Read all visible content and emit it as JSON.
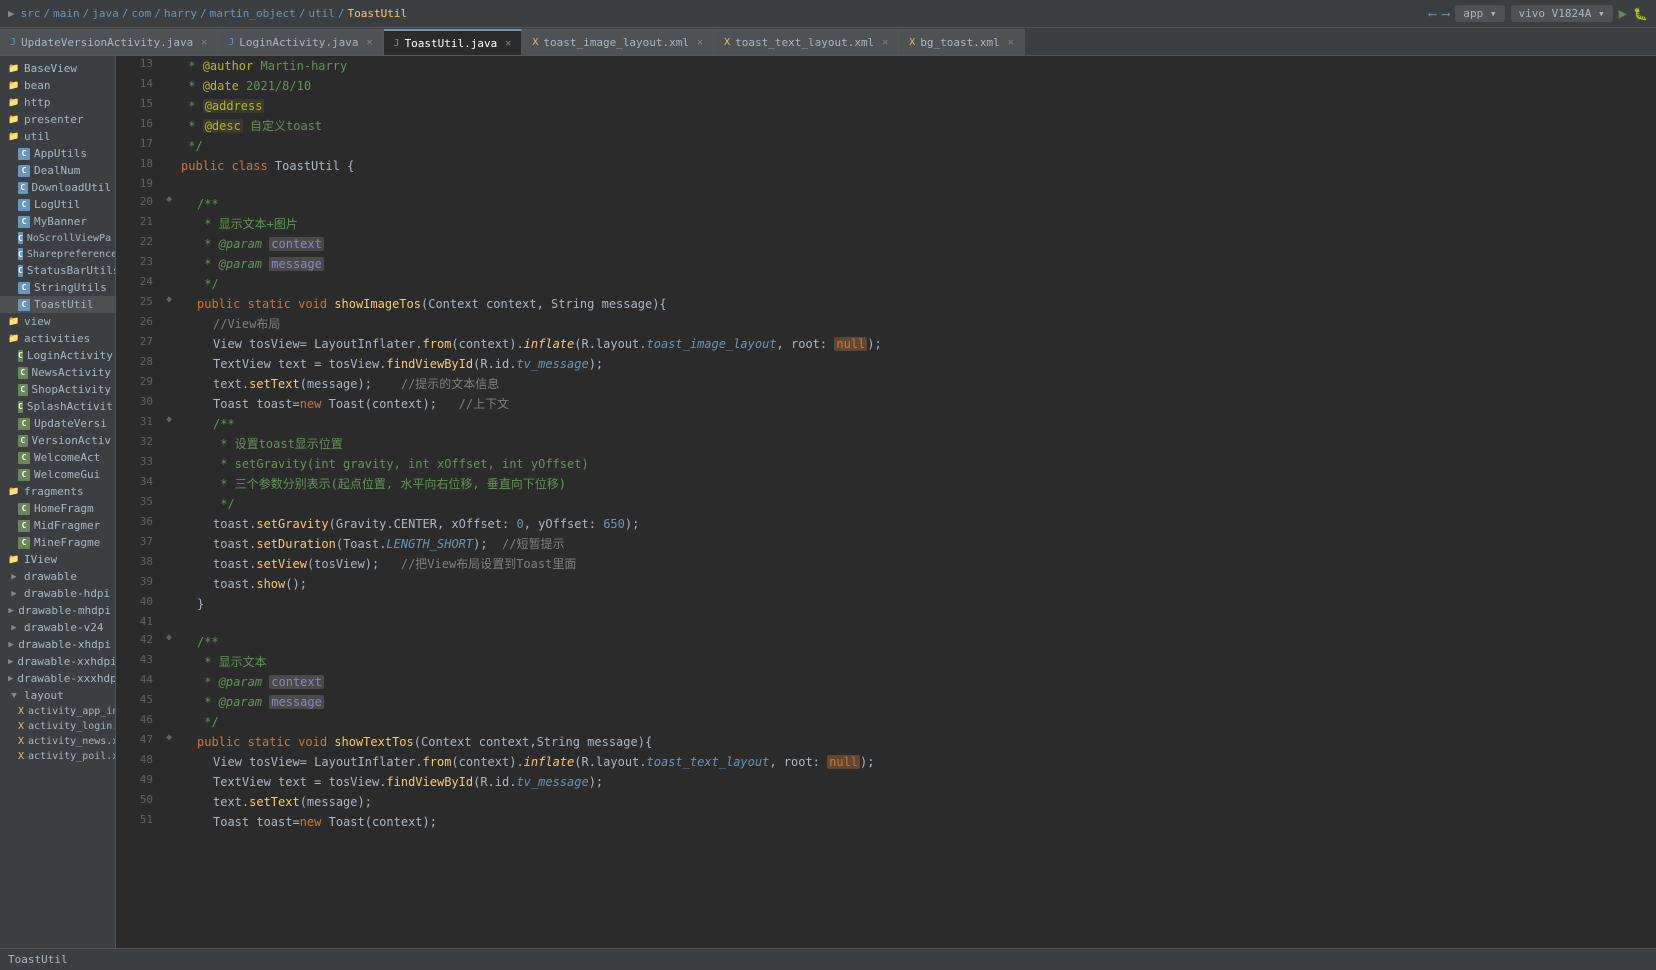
{
  "topbar": {
    "breadcrumbs": [
      "src",
      "main",
      "java",
      "com",
      "harry",
      "martin_object",
      "util",
      "ToastUtil"
    ]
  },
  "tabs": [
    {
      "id": "UpdateVersionActivity",
      "label": "UpdateVersionActivity.java",
      "type": "java",
      "active": false
    },
    {
      "id": "LoginActivity",
      "label": "LoginActivity.java",
      "type": "java",
      "active": false
    },
    {
      "id": "ToastUtil",
      "label": "ToastUtil.java",
      "type": "java",
      "active": true
    },
    {
      "id": "toast_image_layout",
      "label": "toast_image_layout.xml",
      "type": "xml",
      "active": false
    },
    {
      "id": "toast_text_layout",
      "label": "toast_text_layout.xml",
      "type": "xml",
      "active": false
    },
    {
      "id": "bg_toast",
      "label": "bg_toast.xml",
      "type": "xml",
      "active": false
    }
  ],
  "sidebar": {
    "sections": [
      {
        "type": "item",
        "label": "BaseView",
        "icon": "folder"
      },
      {
        "type": "item",
        "label": "bean",
        "icon": "folder"
      },
      {
        "type": "item",
        "label": "http",
        "icon": "folder"
      },
      {
        "type": "item",
        "label": "presenter",
        "icon": "folder"
      },
      {
        "type": "item",
        "label": "util",
        "icon": "folder"
      },
      {
        "type": "class",
        "label": "AppUtils",
        "icon": "blue"
      },
      {
        "type": "class",
        "label": "DealNum",
        "icon": "blue"
      },
      {
        "type": "class",
        "label": "DownloadUtil",
        "icon": "blue"
      },
      {
        "type": "class",
        "label": "LogUtil",
        "icon": "blue"
      },
      {
        "type": "class",
        "label": "MyBanner",
        "icon": "blue"
      },
      {
        "type": "class",
        "label": "NoScrollViewPa",
        "icon": "blue"
      },
      {
        "type": "class",
        "label": "Sharepreferences",
        "icon": "blue"
      },
      {
        "type": "class",
        "label": "StatusBarUtils",
        "icon": "blue"
      },
      {
        "type": "class",
        "label": "StringUtils",
        "icon": "blue"
      },
      {
        "type": "class",
        "label": "ToastUtil",
        "icon": "blue"
      },
      {
        "type": "item",
        "label": "view",
        "icon": "folder"
      },
      {
        "type": "item",
        "label": "activities",
        "icon": "folder"
      },
      {
        "type": "class",
        "label": "LoginActivity",
        "icon": "green"
      },
      {
        "type": "class",
        "label": "NewsActivity",
        "icon": "green"
      },
      {
        "type": "class",
        "label": "ShopActivity",
        "icon": "green"
      },
      {
        "type": "class",
        "label": "SplashActivit",
        "icon": "green"
      },
      {
        "type": "class",
        "label": "UpdateVersi",
        "icon": "green"
      },
      {
        "type": "class",
        "label": "VersionActiv",
        "icon": "green"
      },
      {
        "type": "class",
        "label": "WelcomeAct",
        "icon": "green"
      },
      {
        "type": "class",
        "label": "WelcomeGui",
        "icon": "green"
      },
      {
        "type": "item",
        "label": "fragments",
        "icon": "folder"
      },
      {
        "type": "class",
        "label": "HomeFragm",
        "icon": "green"
      },
      {
        "type": "class",
        "label": "MidFragmer",
        "icon": "green"
      },
      {
        "type": "class",
        "label": "MineFragme",
        "icon": "green"
      },
      {
        "type": "item",
        "label": "IView",
        "icon": "folder"
      },
      {
        "type": "item",
        "label": "drawable",
        "icon": "folder"
      },
      {
        "type": "item",
        "label": "drawable-hdpi",
        "icon": "folder"
      },
      {
        "type": "item",
        "label": "drawable-mhdpi",
        "icon": "folder"
      },
      {
        "type": "item",
        "label": "drawable-v24",
        "icon": "folder"
      },
      {
        "type": "item",
        "label": "drawable-xhdpi",
        "icon": "folder"
      },
      {
        "type": "item",
        "label": "drawable-xxhdpi",
        "icon": "folder"
      },
      {
        "type": "item",
        "label": "drawable-xxxhdpi",
        "icon": "folder"
      },
      {
        "type": "item",
        "label": "layout",
        "icon": "folder"
      },
      {
        "type": "file",
        "label": "activity_app_info.xml",
        "icon": "xml"
      },
      {
        "type": "file",
        "label": "activity_login.xml",
        "icon": "xml"
      },
      {
        "type": "file",
        "label": "activity_news.xml",
        "icon": "xml"
      },
      {
        "type": "file",
        "label": "activity_poil.xml",
        "icon": "xml"
      }
    ]
  },
  "code": {
    "lines": [
      {
        "num": 13,
        "gutter": "",
        "text": " * @author Martin-harry"
      },
      {
        "num": 14,
        "gutter": "",
        "text": " * @date 2021/8/10"
      },
      {
        "num": 15,
        "gutter": "",
        "text": " * @address"
      },
      {
        "num": 16,
        "gutter": "",
        "text": " * @desc 自定义toast"
      },
      {
        "num": 17,
        "gutter": "",
        "text": " */"
      },
      {
        "num": 18,
        "gutter": "",
        "text": "public class ToastUtil {"
      },
      {
        "num": 19,
        "gutter": "",
        "text": ""
      },
      {
        "num": 20,
        "gutter": "◆",
        "text": "    /**"
      },
      {
        "num": 21,
        "gutter": "",
        "text": "     * 显示文本+图片"
      },
      {
        "num": 22,
        "gutter": "",
        "text": "     * @param context"
      },
      {
        "num": 23,
        "gutter": "",
        "text": "     * @param message"
      },
      {
        "num": 24,
        "gutter": "",
        "text": "     */"
      },
      {
        "num": 25,
        "gutter": "◆",
        "text": "    public static void showImageTos(Context context, String message){"
      },
      {
        "num": 26,
        "gutter": "",
        "text": "        //View布局"
      },
      {
        "num": 27,
        "gutter": "",
        "text": "        View tosView= LayoutInflater.from(context).inflate(R.layout.toast_image_layout, root: null);"
      },
      {
        "num": 28,
        "gutter": "",
        "text": "        TextView text = tosView.findViewById(R.id.tv_message);"
      },
      {
        "num": 29,
        "gutter": "",
        "text": "        text.setText(message);    //提示的文本信息"
      },
      {
        "num": 30,
        "gutter": "",
        "text": "        Toast toast=new Toast(context);   //上下文"
      },
      {
        "num": 31,
        "gutter": "◆",
        "text": "        /**"
      },
      {
        "num": 32,
        "gutter": "",
        "text": "         * 设置toast显示位置"
      },
      {
        "num": 33,
        "gutter": "",
        "text": "         * setGravity(int gravity, int xOffset, int yOffset)"
      },
      {
        "num": 34,
        "gutter": "",
        "text": "         * 三个参数分别表示(起点位置, 水平向右位移, 垂直向下位移)"
      },
      {
        "num": 35,
        "gutter": "",
        "text": "         */"
      },
      {
        "num": 36,
        "gutter": "",
        "text": "        toast.setGravity(Gravity.CENTER, xOffset: 0, yOffset: 650);"
      },
      {
        "num": 37,
        "gutter": "",
        "text": "        toast.setDuration(Toast.LENGTH_SHORT);  //短暂提示"
      },
      {
        "num": 38,
        "gutter": "",
        "text": "        toast.setView(tosView);   //把View布局设置到Toast里面"
      },
      {
        "num": 39,
        "gutter": "",
        "text": "        toast.show();"
      },
      {
        "num": 40,
        "gutter": "",
        "text": "    }"
      },
      {
        "num": 41,
        "gutter": "",
        "text": ""
      },
      {
        "num": 42,
        "gutter": "◆",
        "text": "    /**"
      },
      {
        "num": 43,
        "gutter": "",
        "text": "     * 显示文本"
      },
      {
        "num": 44,
        "gutter": "",
        "text": "     * @param context"
      },
      {
        "num": 45,
        "gutter": "",
        "text": "     * @param message"
      },
      {
        "num": 46,
        "gutter": "",
        "text": "     */"
      },
      {
        "num": 47,
        "gutter": "◆",
        "text": "    public static void showTextTos(Context context,String message){"
      },
      {
        "num": 48,
        "gutter": "",
        "text": "        View tosView= LayoutInflater.from(context).inflate(R.layout.toast_text_layout, root: null);"
      },
      {
        "num": 49,
        "gutter": "",
        "text": "        TextView text = tosView.findViewById(R.id.tv_message);"
      },
      {
        "num": 50,
        "gutter": "",
        "text": "        text.setText(message);"
      },
      {
        "num": 51,
        "gutter": "",
        "text": "        Toast toast=new Toast(context);"
      }
    ]
  },
  "statusbar": {
    "label": "ToastUtil"
  }
}
